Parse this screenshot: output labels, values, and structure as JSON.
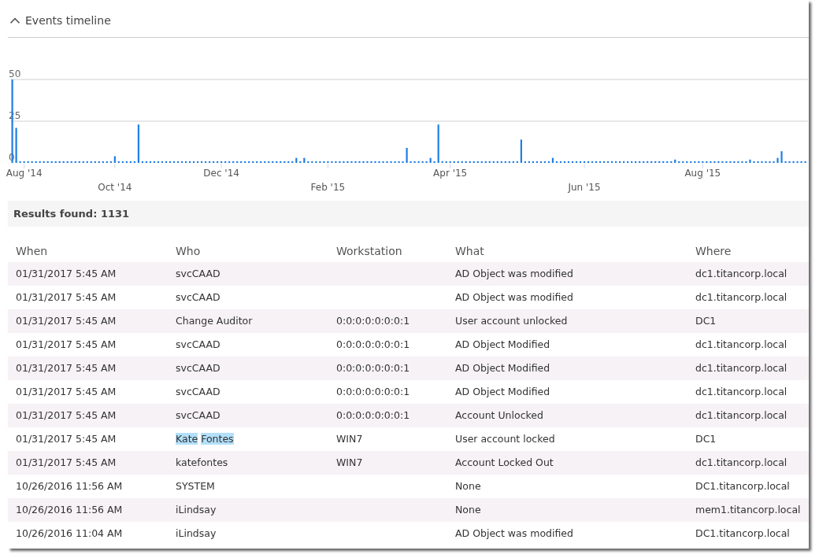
{
  "panel": {
    "title": "Events timeline",
    "expanded": true
  },
  "timeline": {
    "chart_data": {
      "type": "bar",
      "ylim": [
        0,
        50
      ],
      "yticks": [
        0,
        25,
        50
      ],
      "categories": [
        null,
        null,
        null,
        "Aug '14",
        null,
        null,
        null,
        null,
        null,
        null,
        null,
        null,
        null,
        null,
        null,
        null,
        null,
        null,
        null,
        null,
        null,
        null,
        null,
        null,
        null,
        null,
        "Oct '14",
        null,
        null,
        null,
        null,
        null,
        null,
        null,
        null,
        null,
        null,
        null,
        null,
        null,
        null,
        null,
        null,
        null,
        null,
        null,
        null,
        null,
        null,
        null,
        null,
        null,
        null,
        "Dec '14",
        null,
        null,
        null,
        null,
        null,
        null,
        null,
        null,
        null,
        null,
        null,
        null,
        null,
        null,
        null,
        null,
        null,
        null,
        null,
        null,
        null,
        null,
        null,
        null,
        null,
        null,
        "Feb '15",
        null,
        null,
        null,
        null,
        null,
        null,
        null,
        null,
        null,
        null,
        null,
        null,
        null,
        null,
        null,
        null,
        null,
        null,
        null,
        null,
        null,
        null,
        null,
        null,
        null,
        null,
        null,
        null,
        null,
        null,
        "Apr '15",
        null,
        null,
        null,
        null,
        null,
        null,
        null,
        null,
        null,
        null,
        null,
        null,
        null,
        null,
        null,
        null,
        null,
        null,
        null,
        null,
        null,
        null,
        null,
        null,
        null,
        null,
        null,
        null,
        null,
        null,
        null,
        null,
        null,
        "Jun '15",
        null,
        null,
        null,
        null,
        null,
        null,
        null,
        null,
        null,
        null,
        null,
        null,
        null,
        null,
        null,
        null,
        null,
        null,
        null,
        null,
        null,
        null,
        null,
        null,
        null,
        null,
        null,
        null,
        null,
        "Aug '15",
        null,
        null,
        null,
        null,
        null,
        null,
        null,
        null,
        null,
        null,
        null,
        null,
        null,
        null,
        null,
        null,
        null,
        null,
        null,
        null,
        null,
        null,
        null,
        null,
        null,
        null
      ],
      "series": [
        {
          "color": "#1e7ee6",
          "values": [
            50,
            21,
            1,
            1,
            1,
            1,
            1,
            1,
            1,
            1,
            1,
            1,
            1,
            1,
            1,
            1,
            1,
            1,
            1,
            1,
            1,
            1,
            1,
            1,
            1,
            1,
            4,
            1,
            1,
            1,
            1,
            1,
            23,
            1,
            1,
            1,
            1,
            1,
            1,
            1,
            1,
            1,
            1,
            1,
            1,
            1,
            1,
            1,
            1,
            1,
            1,
            1,
            1,
            1,
            1,
            1,
            1,
            1,
            1,
            1,
            1,
            1,
            1,
            1,
            1,
            1,
            1,
            1,
            1,
            1,
            1,
            1,
            3,
            1,
            3,
            1,
            1,
            1,
            1,
            1,
            1,
            1,
            1,
            1,
            1,
            1,
            1,
            1,
            1,
            1,
            1,
            1,
            1,
            1,
            1,
            1,
            1,
            1,
            1,
            1,
            9,
            1,
            1,
            1,
            1,
            1,
            3,
            1,
            23,
            1,
            1,
            1,
            1,
            1,
            1,
            1,
            1,
            1,
            1,
            1,
            1,
            1,
            1,
            1,
            1,
            1,
            1,
            1,
            1,
            14,
            1,
            1,
            1,
            1,
            1,
            1,
            1,
            3,
            1,
            1,
            1,
            1,
            1,
            1,
            1,
            1,
            1,
            1,
            1,
            1,
            1,
            1,
            1,
            1,
            1,
            1,
            1,
            1,
            1,
            1,
            1,
            1,
            1,
            1,
            1,
            1,
            1,
            1,
            2,
            1,
            1,
            1,
            1,
            1,
            1,
            1,
            1,
            1,
            1,
            1,
            1,
            1,
            1,
            1,
            1,
            1,
            1,
            2,
            1,
            1,
            1,
            1,
            1,
            1,
            3,
            7,
            1,
            1,
            1,
            1,
            1,
            1
          ]
        }
      ]
    }
  },
  "results": {
    "label": "Results found: 1131"
  },
  "table": {
    "columns": [
      "When",
      "Who",
      "Workstation",
      "What",
      "Where"
    ],
    "rows": [
      {
        "when": "01/31/2017 5:45 AM",
        "who": "svcCAAD",
        "workstation": "",
        "what": "AD Object was modified",
        "where": "dc1.titancorp.local",
        "who_highlighted": false
      },
      {
        "when": "01/31/2017 5:45 AM",
        "who": "svcCAAD",
        "workstation": "",
        "what": "AD Object was modified",
        "where": "dc1.titancorp.local",
        "who_highlighted": false
      },
      {
        "when": "01/31/2017 5:45 AM",
        "who": "Change Auditor",
        "workstation": "0:0:0:0:0:0:0:1",
        "what": "User account unlocked",
        "where": "DC1",
        "who_highlighted": false
      },
      {
        "when": "01/31/2017 5:45 AM",
        "who": "svcCAAD",
        "workstation": "0:0:0:0:0:0:0:1",
        "what": "AD Object Modified",
        "where": "dc1.titancorp.local",
        "who_highlighted": false
      },
      {
        "when": "01/31/2017 5:45 AM",
        "who": "svcCAAD",
        "workstation": "0:0:0:0:0:0:0:1",
        "what": "AD Object Modified",
        "where": "dc1.titancorp.local",
        "who_highlighted": false
      },
      {
        "when": "01/31/2017 5:45 AM",
        "who": "svcCAAD",
        "workstation": "0:0:0:0:0:0:0:1",
        "what": "AD Object Modified",
        "where": "dc1.titancorp.local",
        "who_highlighted": false
      },
      {
        "when": "01/31/2017 5:45 AM",
        "who": "svcCAAD",
        "workstation": "0:0:0:0:0:0:0:1",
        "what": "Account Unlocked",
        "where": "dc1.titancorp.local",
        "who_highlighted": false
      },
      {
        "when": "01/31/2017 5:45 AM",
        "who": "Kate Fontes",
        "workstation": "WIN7",
        "what": "User account locked",
        "where": "DC1",
        "who_highlighted": true
      },
      {
        "when": "01/31/2017 5:45 AM",
        "who": "katefontes",
        "workstation": "WIN7",
        "what": "Account Locked Out",
        "where": "dc1.titancorp.local",
        "who_highlighted": false
      },
      {
        "when": "10/26/2016 11:56 AM",
        "who": "SYSTEM",
        "workstation": "",
        "what": "None",
        "where": "DC1.titancorp.local",
        "who_highlighted": false
      },
      {
        "when": "10/26/2016 11:56 AM",
        "who": "iLindsay",
        "workstation": "",
        "what": "None",
        "where": "mem1.titancorp.local",
        "who_highlighted": false
      },
      {
        "when": "10/26/2016 11:04 AM",
        "who": "iLindsay",
        "workstation": "",
        "what": "AD Object was modified",
        "where": "DC1.titancorp.local",
        "who_highlighted": false
      }
    ]
  }
}
